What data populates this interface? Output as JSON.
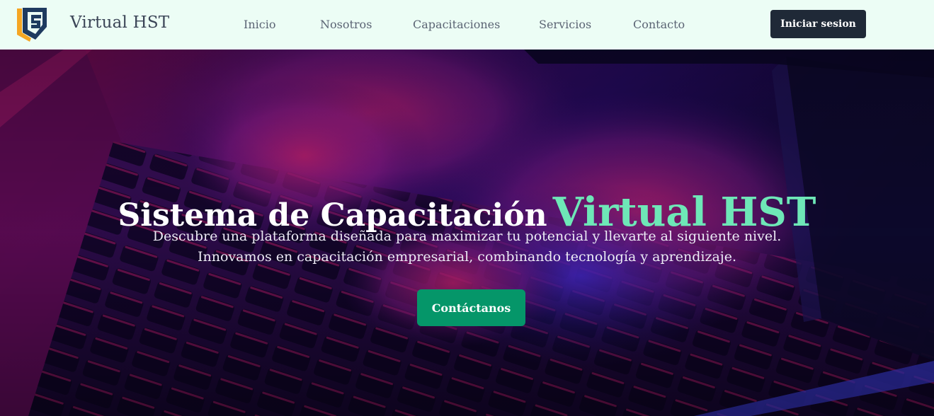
{
  "header": {
    "brand": "Virtual HST",
    "nav": {
      "inicio": "Inicio",
      "nosotros": "Nosotros",
      "capacitaciones": "Capacitaciones",
      "servicios": "Servicios",
      "contacto": "Contacto"
    },
    "login_label": "Iniciar sesion"
  },
  "hero": {
    "title_main": "Sistema de Capacitación",
    "title_accent": "Virtual HST",
    "subtitle_line1": "Descubre una plataforma diseñada para maximizar tu potencial y llevarte al siguiente nivel.",
    "subtitle_line2": "Innovamos en capacitación empresarial, combinando tecnología y aprendizaje.",
    "cta_label": "Contáctanos"
  },
  "colors": {
    "navbar_bg": "#ecfdf5",
    "accent_green": "#6ee7b7",
    "cta_green": "#059669",
    "login_dark": "#1f2937",
    "logo_orange": "#f5a623",
    "logo_navy": "#1e3a5f"
  }
}
